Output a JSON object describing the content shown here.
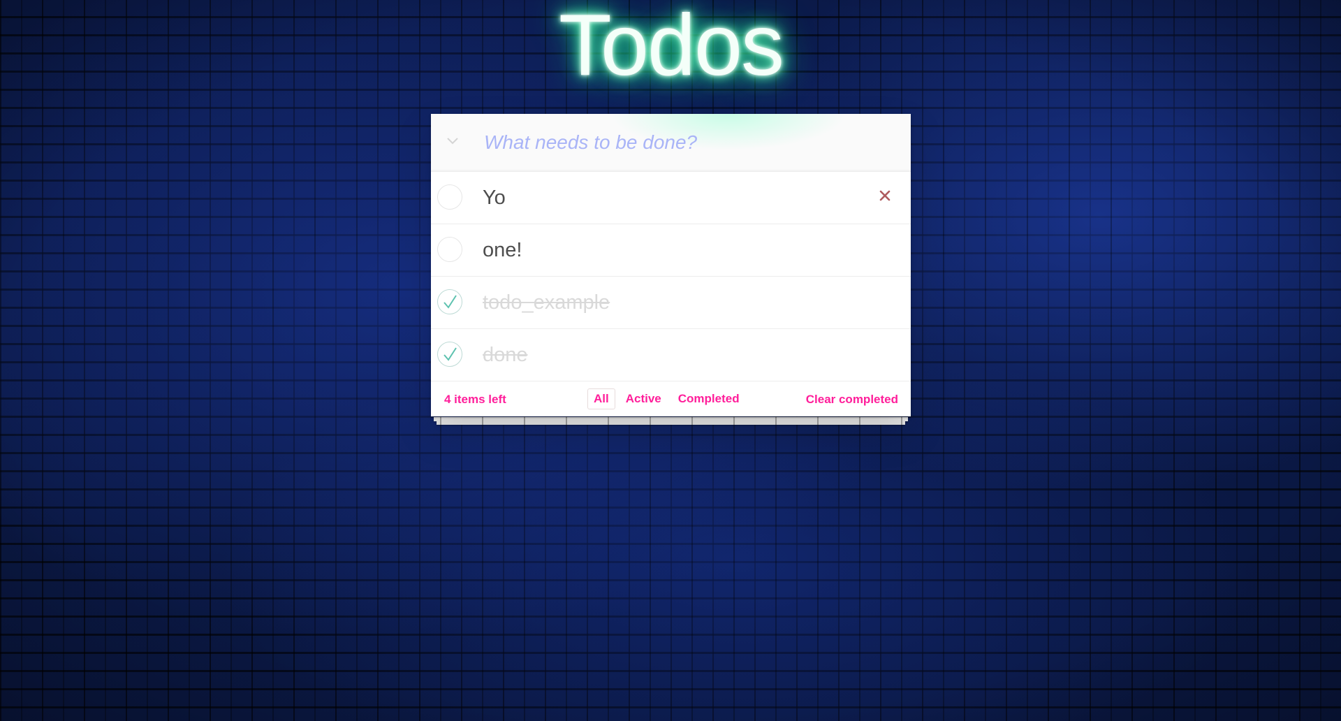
{
  "app": {
    "title": "Todos",
    "new_todo_placeholder": "What needs to be done?",
    "new_todo_value": ""
  },
  "todos": [
    {
      "text": "Yo",
      "completed": false
    },
    {
      "text": "one!",
      "completed": false
    },
    {
      "text": "todo_example",
      "completed": true
    },
    {
      "text": "done",
      "completed": true
    }
  ],
  "footer": {
    "count": "4 items left",
    "filters": [
      "All",
      "Active",
      "Completed"
    ],
    "selected_filter": "All",
    "clear_label": "Clear completed"
  },
  "icons": {
    "toggle_all": "chevron-down-icon",
    "destroy": "close-icon",
    "check": "checkmark-icon"
  },
  "colors": {
    "accent": "#ff1e9a",
    "title_glow": "#2cf59a",
    "placeholder": "#a9b4f7",
    "destroy": "#af5b5e",
    "check": "#5dc2af"
  }
}
